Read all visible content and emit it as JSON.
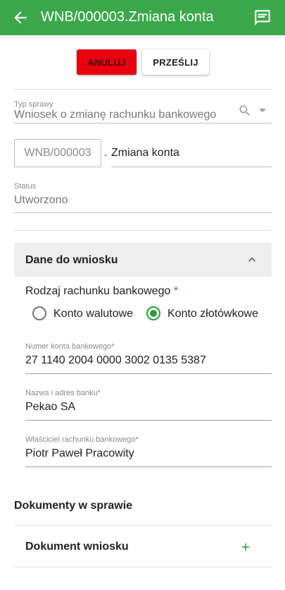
{
  "appbar": {
    "title": "WNB/000003.Zmiana konta",
    "back_icon": "arrow-back-icon",
    "message_icon": "message-icon",
    "color": "#3aa84a"
  },
  "actions": {
    "cancel_label": "ANULUJ",
    "send_label": "PRZEŚLIJ",
    "cancel_color": "#e8000f"
  },
  "case_type": {
    "label": "Typ sprawy",
    "value": "Wniosek o zmianę rachunku bankowego",
    "search_icon": "search-icon",
    "dropdown_icon": "dropdown-icon"
  },
  "number": {
    "prefix": "WNB/000003",
    "separator": ".",
    "name": "Zmiana konta"
  },
  "status": {
    "label": "Status",
    "value": "Utworzono"
  },
  "panel": {
    "title": "Dane do wniosku",
    "collapse_icon": "chevron-up-icon",
    "account_type_label": "Rodzaj rachunku bankowego",
    "required_mark": "*",
    "options": [
      {
        "label": "Konto walutowe",
        "selected": false
      },
      {
        "label": "Konto złotówkowe",
        "selected": true
      }
    ],
    "account_number": {
      "label": "Numer konta bankowego*",
      "value": "27 1140 2004 0000 3002 0135 5387"
    },
    "bank": {
      "label": "Nazwa i adres banku*",
      "value": "Pekao SA"
    },
    "owner": {
      "label": "Właściciel rachunku bankowego*",
      "value": "Piotr Paweł Pracowity"
    }
  },
  "documents": {
    "section_title": "Dokumenty w sprawie",
    "item_label": "Dokument wniosku",
    "add_icon": "plus-icon",
    "accent_color": "#26a03a"
  }
}
